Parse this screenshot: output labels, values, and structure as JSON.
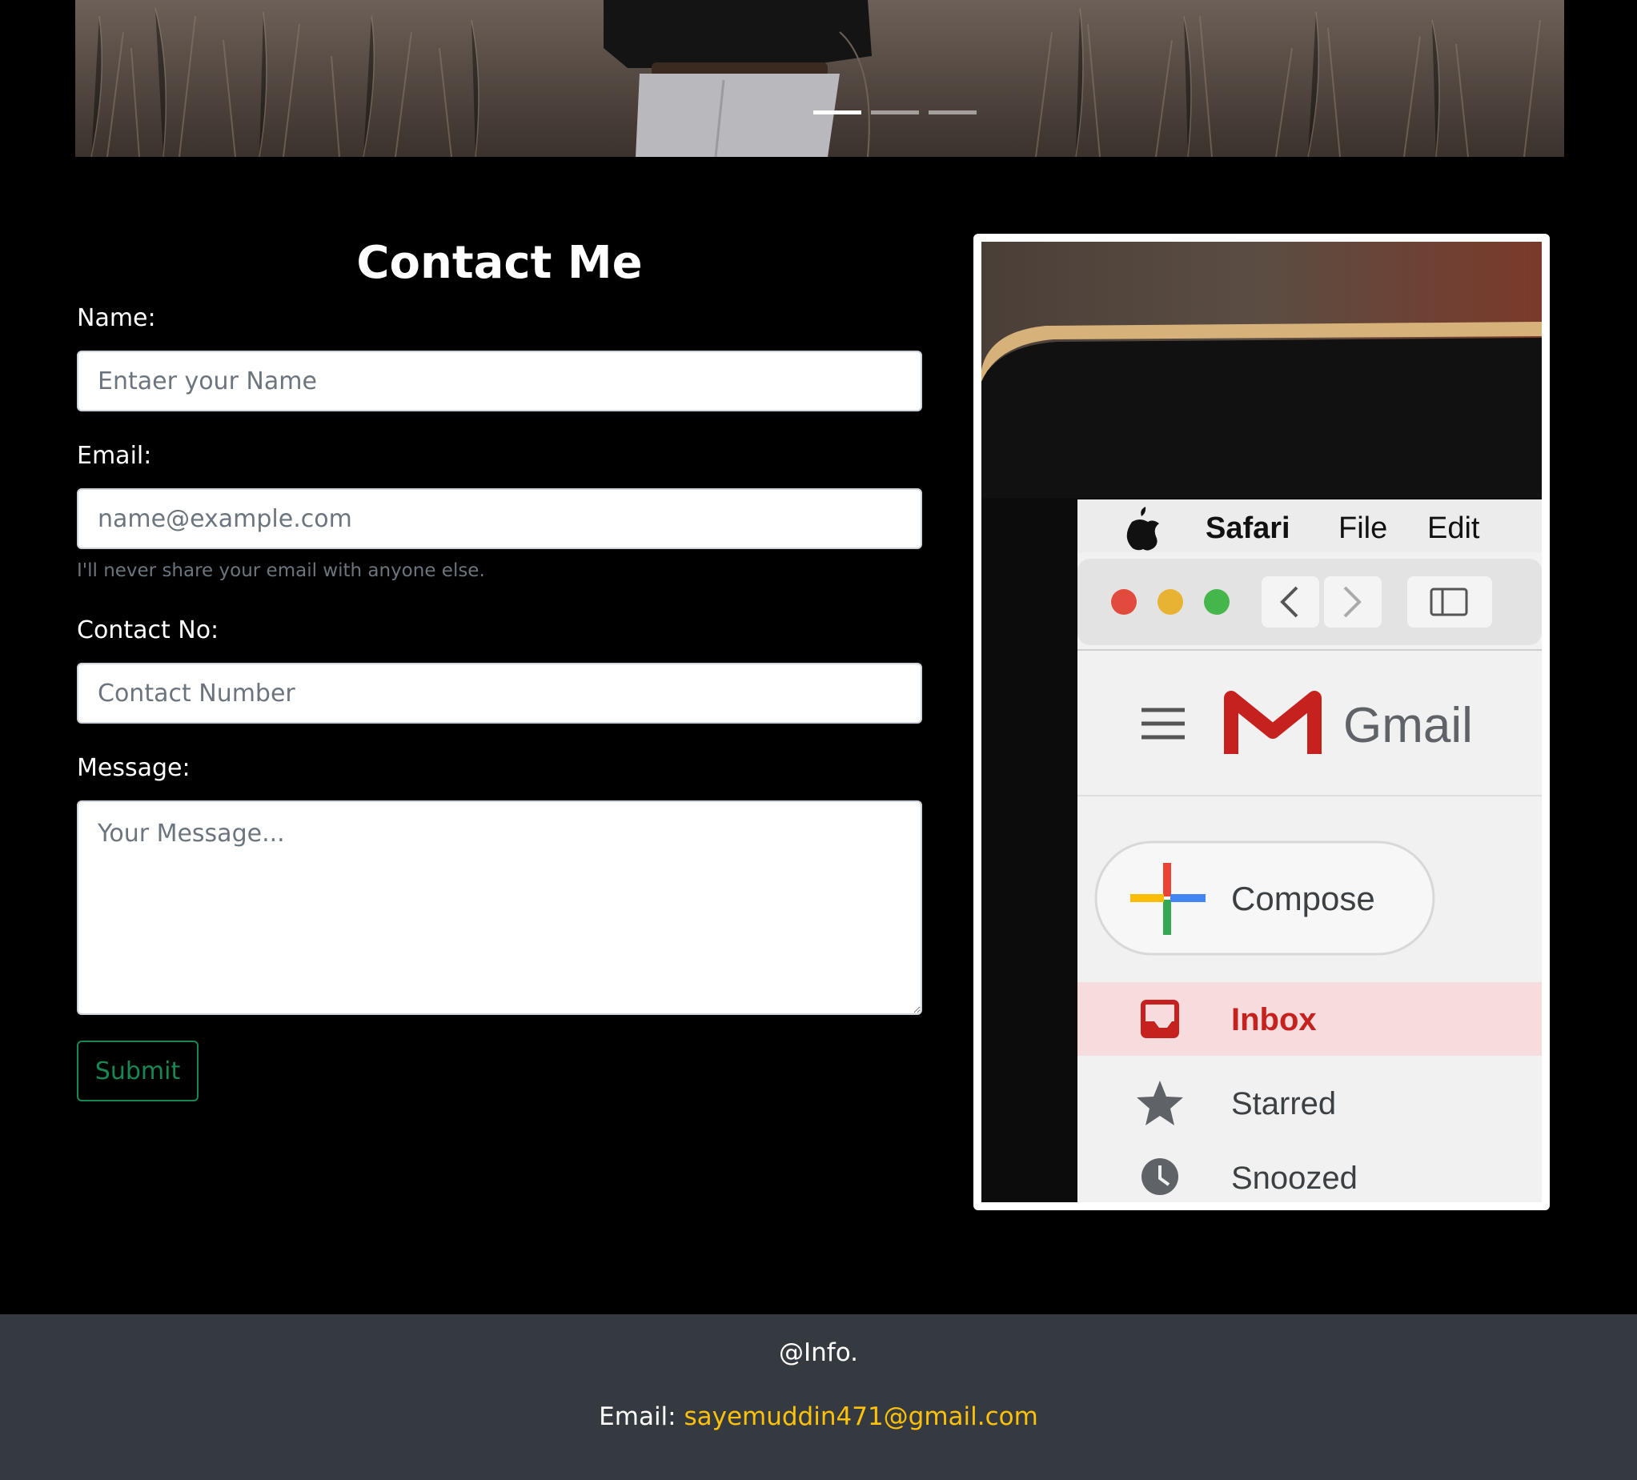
{
  "hero": {
    "slide_count": 3,
    "active_slide": 1
  },
  "contact": {
    "title": "Contact Me",
    "name_label": "Name:",
    "name_placeholder": "Entaer your Name",
    "email_label": "Email:",
    "email_placeholder": "name@example.com",
    "email_help": "I'll never share your email with anyone else.",
    "contact_label": "Contact No:",
    "contact_placeholder": "Contact Number",
    "message_label": "Message:",
    "message_placeholder": "Your Message...",
    "submit_label": "Submit"
  },
  "photo": {
    "menu_app": "Safari",
    "menu_file": "File",
    "menu_edit": "Edit",
    "gmail_title": "Gmail",
    "compose": "Compose",
    "inbox": "Inbox",
    "starred": "Starred",
    "snoozed": "Snoozed"
  },
  "footer": {
    "info": "@Info.",
    "email_label": "Email:",
    "email_link": "sayemuddin471@gmail.com"
  },
  "colors": {
    "submit_border": "#198754",
    "footer_bg": "#343a40",
    "link": "#ffc107"
  }
}
